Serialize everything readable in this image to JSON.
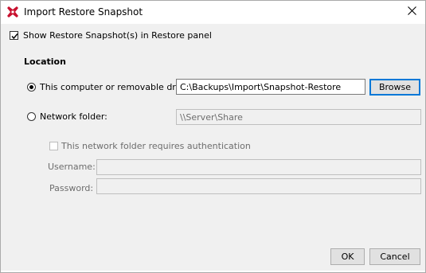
{
  "window": {
    "title": "Import Restore Snapshot",
    "app_icon": "red-cross-icon",
    "close_icon": "close-icon"
  },
  "show_checkbox": {
    "label": "Show Restore Snapshot(s) in Restore panel",
    "checked": true
  },
  "location": {
    "heading": "Location",
    "local_option": {
      "label": "This computer or removable drive:",
      "selected": true,
      "path_value": "C:\\Backups\\Import\\Snapshot-Restore",
      "browse_label": "Browse"
    },
    "network_option": {
      "label": "Network folder:",
      "selected": false,
      "path_placeholder": "\\\\Server\\Share"
    },
    "auth": {
      "checkbox_label": "This network folder requires authentication",
      "checked": false,
      "username_label": "Username:",
      "username_value": "",
      "password_label": "Password:",
      "password_value": ""
    }
  },
  "footer": {
    "ok_label": "OK",
    "cancel_label": "Cancel"
  },
  "colors": {
    "accent": "#0078d7",
    "app_icon": "#c8102e"
  }
}
